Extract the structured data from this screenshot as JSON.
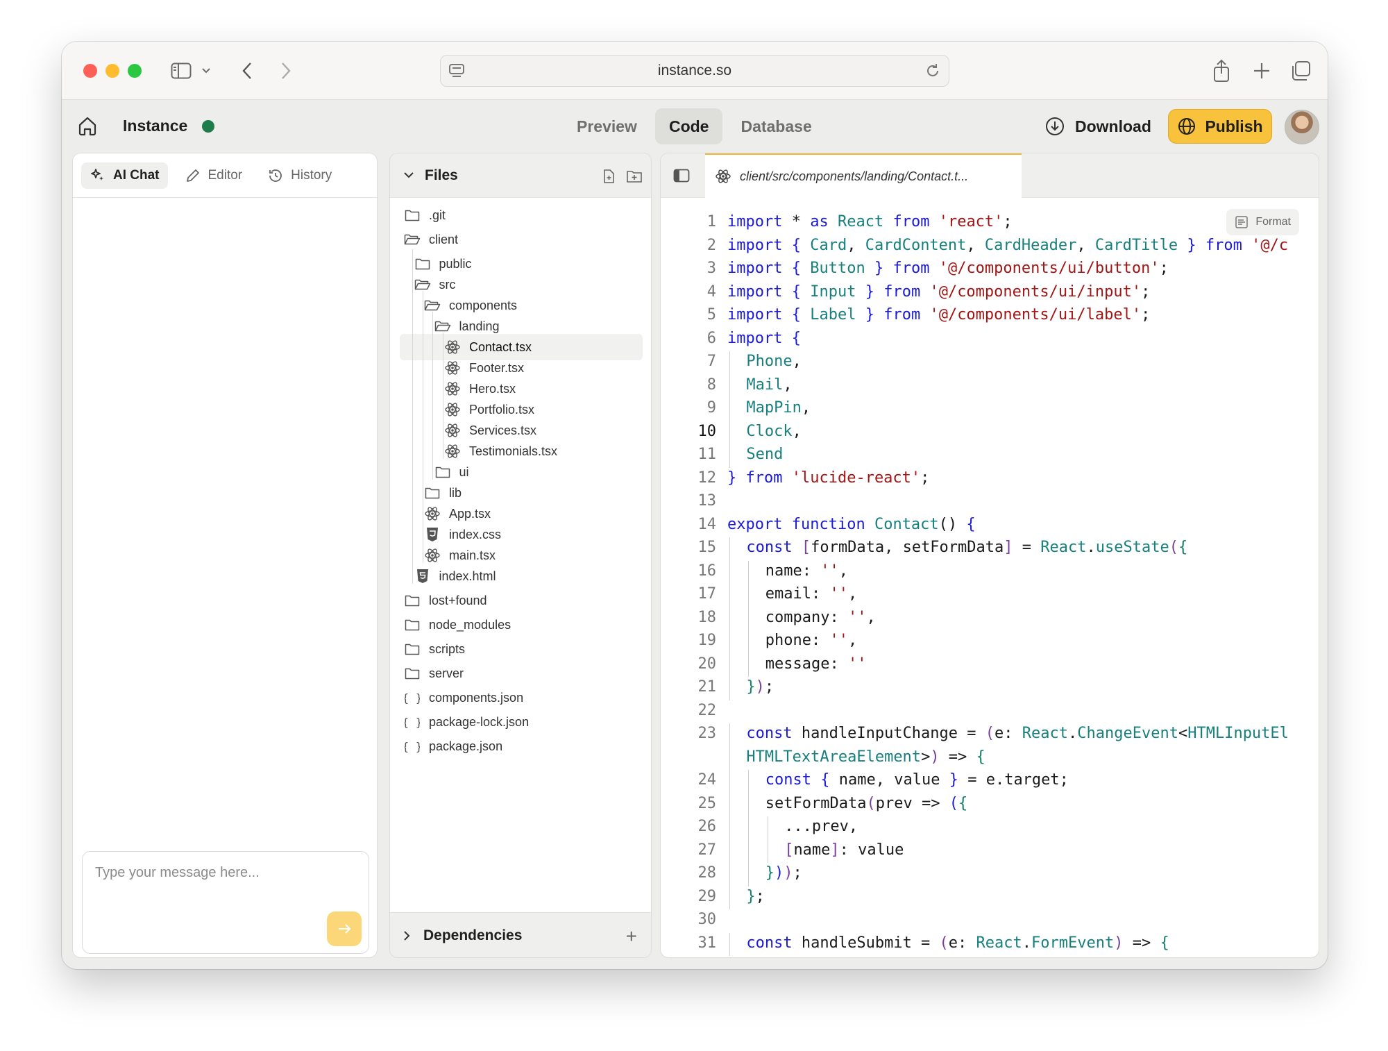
{
  "browser": {
    "url": "instance.so"
  },
  "app": {
    "name": "Instance",
    "tabs": [
      {
        "label": "Preview",
        "active": false
      },
      {
        "label": "Code",
        "active": true
      },
      {
        "label": "Database",
        "active": false
      }
    ],
    "download_label": "Download",
    "publish_label": "Publish",
    "accent_color": "#f9c23c",
    "status_color": "#1c7c4a"
  },
  "chat_panel": {
    "tabs": [
      {
        "label": "AI Chat",
        "icon": "sparkles-icon",
        "active": true
      },
      {
        "label": "Editor",
        "icon": "pencil-icon",
        "active": false
      },
      {
        "label": "History",
        "icon": "history-icon",
        "active": false
      }
    ],
    "input_placeholder": "Type your message here...",
    "send_icon": "arrow-right-icon"
  },
  "files_panel": {
    "title": "Files",
    "dependencies_label": "Dependencies",
    "tree": [
      {
        "name": ".git",
        "type": "folder",
        "depth": 0,
        "open": false
      },
      {
        "name": "client",
        "type": "folder",
        "depth": 0,
        "open": true
      },
      {
        "name": "public",
        "type": "folder",
        "depth": 1,
        "open": false
      },
      {
        "name": "src",
        "type": "folder",
        "depth": 1,
        "open": true
      },
      {
        "name": "components",
        "type": "folder",
        "depth": 2,
        "open": true
      },
      {
        "name": "landing",
        "type": "folder",
        "depth": 3,
        "open": true
      },
      {
        "name": "Contact.tsx",
        "type": "react",
        "depth": 4,
        "selected": true
      },
      {
        "name": "Footer.tsx",
        "type": "react",
        "depth": 4
      },
      {
        "name": "Hero.tsx",
        "type": "react",
        "depth": 4
      },
      {
        "name": "Portfolio.tsx",
        "type": "react",
        "depth": 4
      },
      {
        "name": "Services.tsx",
        "type": "react",
        "depth": 4
      },
      {
        "name": "Testimonials.tsx",
        "type": "react",
        "depth": 4
      },
      {
        "name": "ui",
        "type": "folder",
        "depth": 3,
        "open": false
      },
      {
        "name": "lib",
        "type": "folder",
        "depth": 2,
        "open": false
      },
      {
        "name": "App.tsx",
        "type": "react",
        "depth": 2
      },
      {
        "name": "index.css",
        "type": "css",
        "depth": 2
      },
      {
        "name": "main.tsx",
        "type": "react",
        "depth": 2
      },
      {
        "name": "index.html",
        "type": "html",
        "depth": 1
      },
      {
        "name": "lost+found",
        "type": "folder",
        "depth": 0,
        "open": false
      },
      {
        "name": "node_modules",
        "type": "folder",
        "depth": 0,
        "open": false
      },
      {
        "name": "scripts",
        "type": "folder",
        "depth": 0,
        "open": false
      },
      {
        "name": "server",
        "type": "folder",
        "depth": 0,
        "open": false
      },
      {
        "name": "components.json",
        "type": "json",
        "depth": 0
      },
      {
        "name": "package-lock.json",
        "type": "json",
        "depth": 0
      },
      {
        "name": "package.json",
        "type": "json",
        "depth": 0
      }
    ]
  },
  "editor": {
    "tab_path": "client/src/components/landing/Contact.t...",
    "format_label": "Format",
    "current_line": 10,
    "lines": [
      {
        "n": "1",
        "indent": 0,
        "tokens": [
          [
            "k",
            "import"
          ],
          [
            "p",
            " * "
          ],
          [
            "k",
            "as"
          ],
          [
            "p",
            " "
          ],
          [
            "t",
            "React"
          ],
          [
            "p",
            " "
          ],
          [
            "k",
            "from"
          ],
          [
            "p",
            " "
          ],
          [
            "s",
            "'react'"
          ],
          [
            "p",
            ";"
          ]
        ]
      },
      {
        "n": "2",
        "indent": 0,
        "tokens": [
          [
            "k",
            "import"
          ],
          [
            "p",
            " "
          ],
          [
            "b1",
            "{"
          ],
          [
            "p",
            " "
          ],
          [
            "t",
            "Card"
          ],
          [
            "p",
            ", "
          ],
          [
            "t",
            "CardContent"
          ],
          [
            "p",
            ", "
          ],
          [
            "t",
            "CardHeader"
          ],
          [
            "p",
            ", "
          ],
          [
            "t",
            "CardTitle"
          ],
          [
            "p",
            " "
          ],
          [
            "b1",
            "}"
          ],
          [
            "p",
            " "
          ],
          [
            "k",
            "from"
          ],
          [
            "p",
            " "
          ],
          [
            "s",
            "'@/c"
          ]
        ]
      },
      {
        "n": "3",
        "indent": 0,
        "tokens": [
          [
            "k",
            "import"
          ],
          [
            "p",
            " "
          ],
          [
            "b1",
            "{"
          ],
          [
            "p",
            " "
          ],
          [
            "t",
            "Button"
          ],
          [
            "p",
            " "
          ],
          [
            "b1",
            "}"
          ],
          [
            "p",
            " "
          ],
          [
            "k",
            "from"
          ],
          [
            "p",
            " "
          ],
          [
            "s",
            "'@/components/ui/button'"
          ],
          [
            "p",
            ";"
          ]
        ]
      },
      {
        "n": "4",
        "indent": 0,
        "tokens": [
          [
            "k",
            "import"
          ],
          [
            "p",
            " "
          ],
          [
            "b1",
            "{"
          ],
          [
            "p",
            " "
          ],
          [
            "t",
            "Input"
          ],
          [
            "p",
            " "
          ],
          [
            "b1",
            "}"
          ],
          [
            "p",
            " "
          ],
          [
            "k",
            "from"
          ],
          [
            "p",
            " "
          ],
          [
            "s",
            "'@/components/ui/input'"
          ],
          [
            "p",
            ";"
          ]
        ]
      },
      {
        "n": "5",
        "indent": 0,
        "tokens": [
          [
            "k",
            "import"
          ],
          [
            "p",
            " "
          ],
          [
            "b1",
            "{"
          ],
          [
            "p",
            " "
          ],
          [
            "t",
            "Label"
          ],
          [
            "p",
            " "
          ],
          [
            "b1",
            "}"
          ],
          [
            "p",
            " "
          ],
          [
            "k",
            "from"
          ],
          [
            "p",
            " "
          ],
          [
            "s",
            "'@/components/ui/label'"
          ],
          [
            "p",
            ";"
          ]
        ]
      },
      {
        "n": "6",
        "indent": 0,
        "tokens": [
          [
            "k",
            "import"
          ],
          [
            "p",
            " "
          ],
          [
            "b1",
            "{"
          ]
        ]
      },
      {
        "n": "7",
        "indent": 1,
        "tokens": [
          [
            "t",
            "Phone"
          ],
          [
            "p",
            ","
          ]
        ]
      },
      {
        "n": "8",
        "indent": 1,
        "tokens": [
          [
            "t",
            "Mail"
          ],
          [
            "p",
            ","
          ]
        ]
      },
      {
        "n": "9",
        "indent": 1,
        "tokens": [
          [
            "t",
            "MapPin"
          ],
          [
            "p",
            ","
          ]
        ]
      },
      {
        "n": "10",
        "indent": 1,
        "tokens": [
          [
            "t",
            "Clock"
          ],
          [
            "p",
            ","
          ]
        ]
      },
      {
        "n": "11",
        "indent": 1,
        "tokens": [
          [
            "t",
            "Send"
          ]
        ]
      },
      {
        "n": "12",
        "indent": 0,
        "tokens": [
          [
            "b1",
            "}"
          ],
          [
            "p",
            " "
          ],
          [
            "k",
            "from"
          ],
          [
            "p",
            " "
          ],
          [
            "s",
            "'lucide-react'"
          ],
          [
            "p",
            ";"
          ]
        ]
      },
      {
        "n": "13",
        "indent": 0,
        "tokens": []
      },
      {
        "n": "14",
        "indent": 0,
        "tokens": [
          [
            "k",
            "export"
          ],
          [
            "p",
            " "
          ],
          [
            "k",
            "function"
          ],
          [
            "p",
            " "
          ],
          [
            "t",
            "Contact"
          ],
          [
            "p",
            "() "
          ],
          [
            "b1",
            "{"
          ]
        ]
      },
      {
        "n": "15",
        "indent": 1,
        "tokens": [
          [
            "k",
            "const"
          ],
          [
            "p",
            " "
          ],
          [
            "b2",
            "["
          ],
          [
            "p",
            "formData, setFormData"
          ],
          [
            "b2",
            "]"
          ],
          [
            "p",
            " = "
          ],
          [
            "t",
            "React"
          ],
          [
            "p",
            "."
          ],
          [
            "t",
            "useState"
          ],
          [
            "b2",
            "("
          ],
          [
            "b3",
            "{"
          ]
        ]
      },
      {
        "n": "16",
        "indent": 2,
        "tokens": [
          [
            "p",
            "name: "
          ],
          [
            "s",
            "''"
          ],
          [
            "p",
            ","
          ]
        ]
      },
      {
        "n": "17",
        "indent": 2,
        "tokens": [
          [
            "p",
            "email: "
          ],
          [
            "s",
            "''"
          ],
          [
            "p",
            ","
          ]
        ]
      },
      {
        "n": "18",
        "indent": 2,
        "tokens": [
          [
            "p",
            "company: "
          ],
          [
            "s",
            "''"
          ],
          [
            "p",
            ","
          ]
        ]
      },
      {
        "n": "19",
        "indent": 2,
        "tokens": [
          [
            "p",
            "phone: "
          ],
          [
            "s",
            "''"
          ],
          [
            "p",
            ","
          ]
        ]
      },
      {
        "n": "20",
        "indent": 2,
        "tokens": [
          [
            "p",
            "message: "
          ],
          [
            "s",
            "''"
          ]
        ]
      },
      {
        "n": "21",
        "indent": 1,
        "tokens": [
          [
            "b3",
            "}"
          ],
          [
            "b2",
            ")"
          ],
          [
            "p",
            ";"
          ]
        ]
      },
      {
        "n": "22",
        "indent": 0,
        "tokens": []
      },
      {
        "n": "23",
        "indent": 1,
        "tokens": [
          [
            "k",
            "const"
          ],
          [
            "p",
            " handleInputChange = "
          ],
          [
            "b2",
            "("
          ],
          [
            "p",
            "e: "
          ],
          [
            "t",
            "React"
          ],
          [
            "p",
            "."
          ],
          [
            "t",
            "ChangeEvent"
          ],
          [
            "p",
            "<"
          ],
          [
            "t",
            "HTMLInputEl"
          ]
        ]
      },
      {
        "n": "",
        "indent": 1,
        "tokens": [
          [
            "t",
            "HTMLTextAreaElement"
          ],
          [
            "p",
            ">"
          ],
          [
            "b2",
            ")"
          ],
          [
            "p",
            " => "
          ],
          [
            "b3",
            "{"
          ]
        ]
      },
      {
        "n": "24",
        "indent": 2,
        "tokens": [
          [
            "k",
            "const"
          ],
          [
            "p",
            " "
          ],
          [
            "b1",
            "{"
          ],
          [
            "p",
            " name, value "
          ],
          [
            "b1",
            "}"
          ],
          [
            "p",
            " = e.target;"
          ]
        ]
      },
      {
        "n": "25",
        "indent": 2,
        "tokens": [
          [
            "p",
            "setFormData"
          ],
          [
            "b2",
            "("
          ],
          [
            "p",
            "prev => "
          ],
          [
            "b1",
            "("
          ],
          [
            "b3",
            "{"
          ]
        ]
      },
      {
        "n": "26",
        "indent": 3,
        "tokens": [
          [
            "p",
            "...prev,"
          ]
        ]
      },
      {
        "n": "27",
        "indent": 3,
        "tokens": [
          [
            "b2",
            "["
          ],
          [
            "p",
            "name"
          ],
          [
            "b2",
            "]"
          ],
          [
            "p",
            ": value"
          ]
        ]
      },
      {
        "n": "28",
        "indent": 2,
        "tokens": [
          [
            "b3",
            "}"
          ],
          [
            "b1",
            ")"
          ],
          [
            "b2",
            ")"
          ],
          [
            "p",
            ";"
          ]
        ]
      },
      {
        "n": "29",
        "indent": 1,
        "tokens": [
          [
            "b3",
            "}"
          ],
          [
            "p",
            ";"
          ]
        ]
      },
      {
        "n": "30",
        "indent": 0,
        "tokens": []
      },
      {
        "n": "31",
        "indent": 1,
        "tokens": [
          [
            "k",
            "const"
          ],
          [
            "p",
            " handleSubmit = "
          ],
          [
            "b2",
            "("
          ],
          [
            "p",
            "e: "
          ],
          [
            "t",
            "React"
          ],
          [
            "p",
            "."
          ],
          [
            "t",
            "FormEvent"
          ],
          [
            "b2",
            ")"
          ],
          [
            "p",
            " => "
          ],
          [
            "b3",
            "{"
          ]
        ]
      }
    ]
  }
}
